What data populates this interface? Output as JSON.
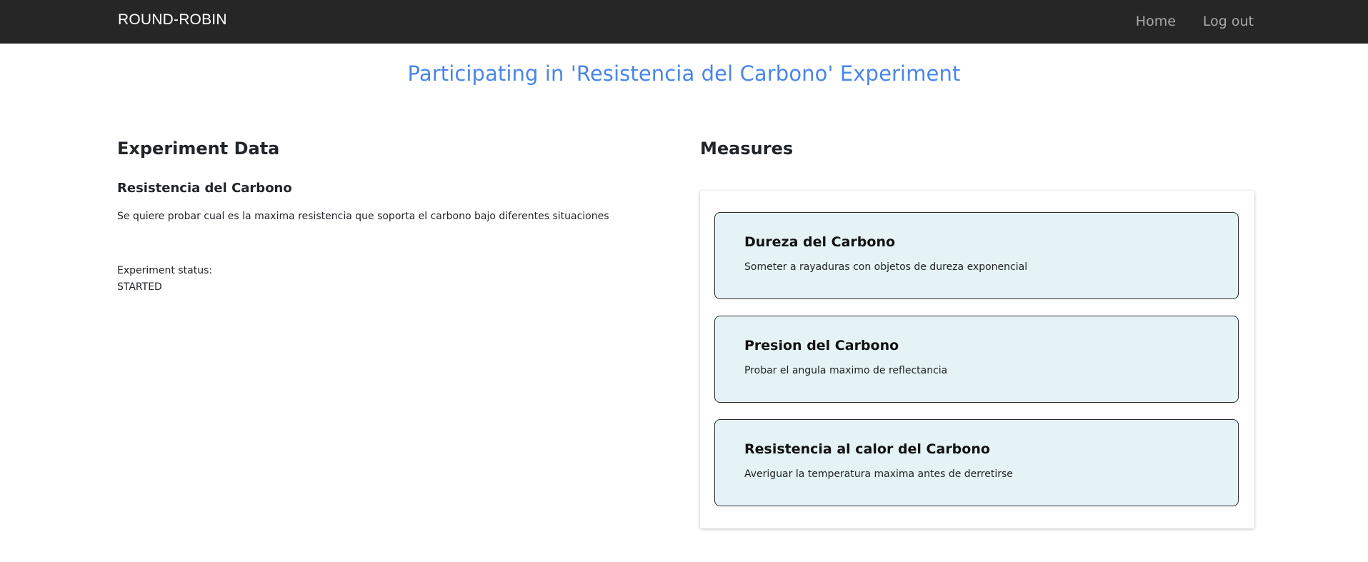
{
  "navbar": {
    "brand": "ROUND-ROBIN",
    "links": [
      {
        "label": "Home"
      },
      {
        "label": "Log out"
      }
    ]
  },
  "page": {
    "title": "Participating in 'Resistencia del Carbono' Experiment"
  },
  "experiment": {
    "section_title": "Experiment Data",
    "name": "Resistencia del Carbono",
    "description": "Se quiere probar cual es la maxima resistencia que soporta el carbono bajo diferentes situaciones",
    "status_label": "Experiment status:",
    "status_value": "STARTED"
  },
  "measures": {
    "section_title": "Measures",
    "items": [
      {
        "title": "Dureza del Carbono",
        "description": "Someter a rayaduras con objetos de dureza exponencial"
      },
      {
        "title": "Presion del Carbono",
        "description": "Probar el angula maximo de reflectancia"
      },
      {
        "title": "Resistencia al calor del Carbono",
        "description": "Averiguar la temperatura maxima antes de derretirse"
      }
    ]
  },
  "colors": {
    "navbar_bg": "#262626",
    "title_accent": "#4a86e8",
    "card_bg": "#e5f3f6"
  }
}
